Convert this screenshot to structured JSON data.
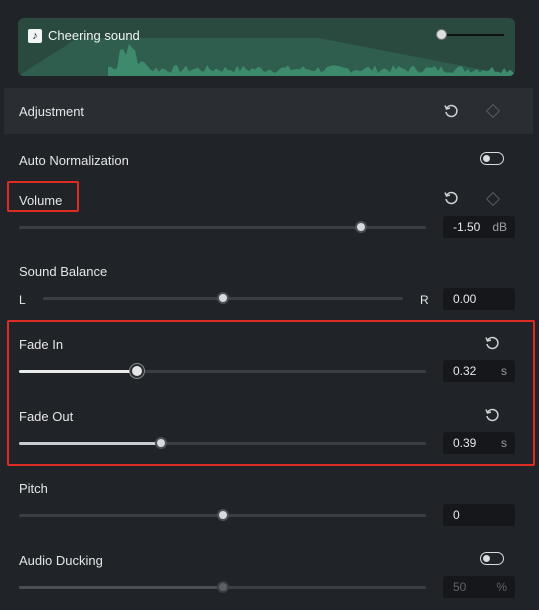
{
  "clip": {
    "title": "Cheering sound",
    "icon": "music-note-icon"
  },
  "adjustment": {
    "header": "Adjustment",
    "auto_normalization": {
      "label": "Auto Normalization",
      "enabled": false
    },
    "volume": {
      "label": "Volume",
      "value": "-1.50",
      "unit": "dB",
      "level": 0.84
    },
    "sound_balance": {
      "label": "Sound Balance",
      "left": "L",
      "right": "R",
      "value": "0.00",
      "level": 0.5
    },
    "fade_in": {
      "label": "Fade In",
      "value": "0.32",
      "unit": "s",
      "level": 0.29
    },
    "fade_out": {
      "label": "Fade Out",
      "value": "0.39",
      "unit": "s",
      "level": 0.35
    },
    "pitch": {
      "label": "Pitch",
      "value": "0",
      "level": 0.5
    },
    "audio_ducking": {
      "label": "Audio Ducking",
      "enabled": false,
      "value": "50",
      "unit": "%",
      "level": 0.5
    }
  },
  "colors": {
    "background": "#202327",
    "clip_background": "#2a4a40",
    "waveform": "#3d8a6c",
    "highlight": "#e02b22"
  }
}
